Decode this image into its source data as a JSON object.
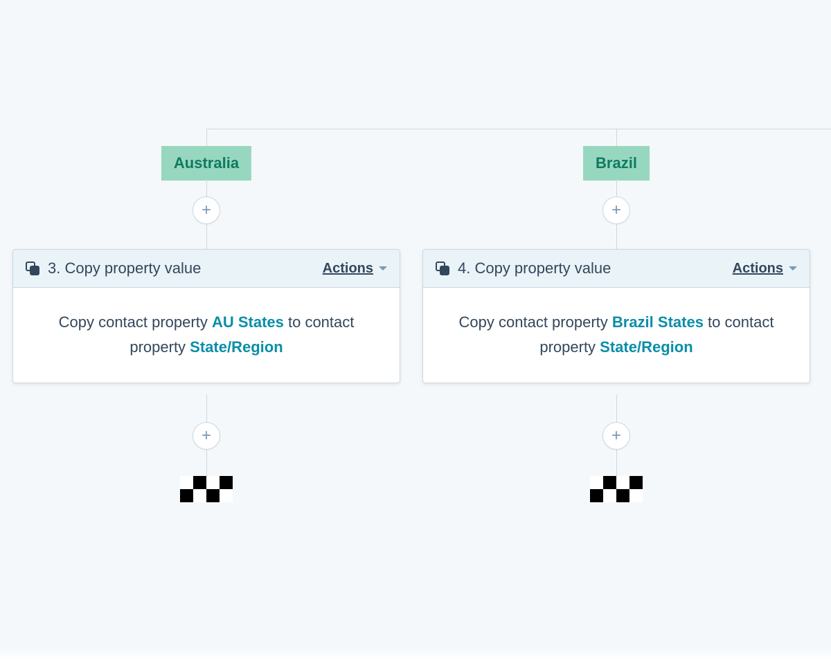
{
  "branches": [
    {
      "tag": "Australia",
      "card": {
        "title": "3. Copy property value",
        "actions_label": "Actions",
        "body_prefix": "Copy contact property ",
        "source_property": "AU States",
        "body_mid": " to contact property ",
        "target_property": "State/Region"
      }
    },
    {
      "tag": "Brazil",
      "card": {
        "title": "4. Copy property value",
        "actions_label": "Actions",
        "body_prefix": "Copy contact property ",
        "source_property": "Brazil States",
        "body_mid": " to contact property ",
        "target_property": "State/Region"
      }
    }
  ]
}
